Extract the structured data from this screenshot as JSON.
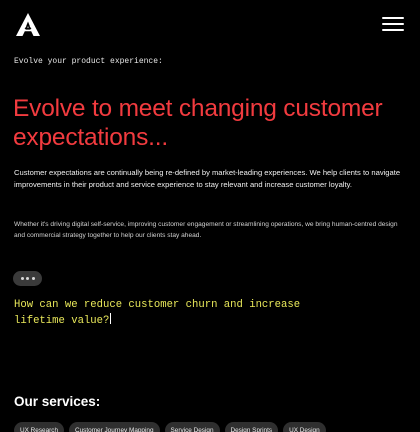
{
  "header": {
    "logo_icon": "abstract-a-logo-icon",
    "menu_icon": "hamburger-menu-icon"
  },
  "eyebrow": "Evolve your product experience:",
  "hero_title": "Evolve to meet changing customer expectations...",
  "paragraph1": "Customer expectations are continually being re-defined by market-leading experiences. We help clients to navigate improvements in their product and service experience to stay relevant and increase customer loyalty.",
  "paragraph2": "Whether it's driving digital self-service, improving customer engagement or streamlining operations, we bring human-centred design and commercial strategy together to help our clients stay ahead.",
  "typing_indicator_icon": "typing-dots-icon",
  "prompt": "How can we reduce customer churn and increase lifetime value?",
  "services": {
    "heading": "Our services:",
    "items": [
      "UX Research",
      "Customer Journey Mapping",
      "Service Design",
      "Design Sprints",
      "UX Design"
    ]
  },
  "colors": {
    "background": "#000000",
    "accent_red": "#f23b3f",
    "prompt_yellow": "#e9e85a",
    "chip_bg": "#2f2f2f"
  }
}
